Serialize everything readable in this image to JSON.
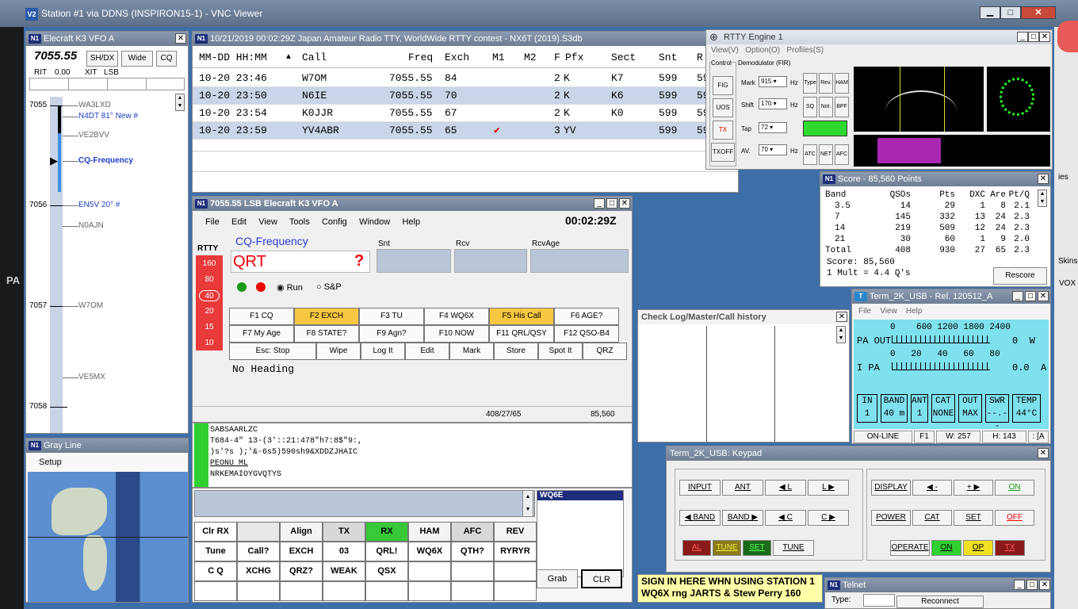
{
  "vnc": {
    "title": "Station #1 via DDNS (INSPIRON15-1) - VNC Viewer",
    "logo": "V2"
  },
  "bandmap": {
    "title": "Elecraft K3 VFO A",
    "freq": "7055.55",
    "btn_shdx": "SH/DX",
    "btn_wide": "Wide",
    "btn_cq": "CQ",
    "rit": "RIT",
    "rit_val": "0.00",
    "xit": "XIT",
    "mode": "LSB",
    "ticks": [
      {
        "label": "7055"
      },
      {
        "label": "7056"
      },
      {
        "label": "7057"
      },
      {
        "label": "7058"
      }
    ],
    "spots": [
      {
        "call": "WA3LXD",
        "color": "gray"
      },
      {
        "call": "N4DT 81° New #",
        "color": "blue"
      },
      {
        "call": "VE2BVV",
        "color": "gray"
      },
      {
        "call": "CQ-Frequency",
        "color": "blue"
      },
      {
        "call": "EN5V 20° #",
        "color": "blue"
      },
      {
        "call": "N0AJN",
        "color": "gray"
      },
      {
        "call": "W7OM",
        "color": "gray"
      },
      {
        "call": "VE5MX",
        "color": "gray"
      }
    ]
  },
  "grayline": {
    "title": "Gray Line",
    "setup": "Setup"
  },
  "log": {
    "title": "10/21/2019 00:02:29Z  Japan Amateur Radio TTY, WorldWide RTTY contest - NX6T (2019).S3db",
    "headers": [
      "MM-DD HH:MM",
      "Call",
      "Freq",
      "Exch",
      "M1",
      "M2",
      "F",
      "Pfx",
      "Sect",
      "Snt",
      "R"
    ],
    "rows": [
      {
        "dt": "10-20 23:46",
        "call": "W7OM",
        "freq": "7055.55",
        "exch": "84",
        "m1": "",
        "f": "2",
        "pfx": "K",
        "sect": "K7",
        "snt": "599",
        "r": "59"
      },
      {
        "dt": "10-20 23:50",
        "call": "N6IE",
        "freq": "7055.55",
        "exch": "70",
        "m1": "",
        "f": "2",
        "pfx": "K",
        "sect": "K6",
        "snt": "599",
        "r": "59"
      },
      {
        "dt": "10-20 23:54",
        "call": "K0JJR",
        "freq": "7055.55",
        "exch": "67",
        "m1": "",
        "f": "2",
        "pfx": "K",
        "sect": "K0",
        "snt": "599",
        "r": "59"
      },
      {
        "dt": "10-20 23:59",
        "call": "YV4ABR",
        "freq": "7055.55",
        "exch": "65",
        "m1": "✔",
        "f": "3",
        "pfx": "YV",
        "sect": "",
        "snt": "599",
        "r": "59"
      }
    ]
  },
  "entry": {
    "title": "7055.55 LSB Elecraft K3 VFO A",
    "menu": [
      "File",
      "Edit",
      "View",
      "Tools",
      "Config",
      "Window",
      "Help"
    ],
    "clock": "00:02:29Z",
    "mode": "RTTY",
    "freq_label": "CQ-Frequency",
    "call": "QRT",
    "q": "?",
    "snt": "Snt",
    "rcv": "Rcv",
    "rcvage": "RcvAge",
    "run": "Run",
    "sp": "S&P",
    "levels": [
      "160",
      "80",
      "40",
      "20",
      "15",
      "10"
    ],
    "fkeys": [
      "F1 CQ",
      "F2 EXCH",
      "F3 TU",
      "F4 WQ6X",
      "F5 His Call",
      "F6 AGE?",
      "F7 My Age",
      "F8 STATE?",
      "F9 Agn?",
      "F10 NOW",
      "F11 QRL/QSY",
      "F12 QSO-B4"
    ],
    "actions": [
      "Esc: Stop",
      "Wipe",
      "Log It",
      "Edit",
      "Mark",
      "Store",
      "Spot It",
      "QRZ"
    ],
    "heading": "No Heading",
    "status_count": "408/27/65",
    "status_score": "85,560"
  },
  "rtty": {
    "title": "RTTY Engine 1",
    "menu": [
      "View(V)",
      "Option(O)",
      "Profiles(S)"
    ],
    "control": "Control",
    "demod": "Demodulator (FIR)",
    "left_btns": [
      "FIG",
      "UOS",
      "TX",
      "TXOFF"
    ],
    "mark_lbl": "Mark",
    "mark_val": "915",
    "shift_lbl": "Shift",
    "shift_val": "170",
    "tap_lbl": "Tap",
    "tap_val": "72",
    "av_lbl": "AV.",
    "av_val": "70",
    "hz": "Hz",
    "r_btns": [
      "Type",
      "Rev.",
      "HAM",
      "SQ",
      "Not.",
      "BPF",
      "ATC",
      "NET",
      "AFC"
    ]
  },
  "rxtext": {
    "lines": [
      "SABSAARLZC",
      "T684-4\" 13-(3'::21:478\"h7:8$\"9:,",
      ")s'?s );'&-6s5)590sh9&XDDZJHAIC",
      "PEONU ML",
      "NRKEMAIOYGVQTYS"
    ]
  },
  "macros": {
    "rows": [
      [
        "Clr RX",
        "",
        "Align",
        "TX",
        "RX",
        "HAM",
        "AFC",
        "REV"
      ],
      [
        "Tune",
        "Call?",
        "EXCH",
        "03",
        "QRL!",
        "WQ6X",
        "QTH?",
        "RYRYR"
      ],
      [
        "C Q",
        "XCHG",
        "QRZ?",
        "WEAK",
        "QSX",
        "",
        "",
        ""
      ]
    ],
    "call_box": "WQ6E",
    "grab": "Grab",
    "clr": "CLR"
  },
  "score": {
    "title": "Score - 85,560 Points",
    "headers": [
      "Band",
      "QSOs",
      "Pts",
      "DXC",
      "Are",
      "Pt/Q"
    ],
    "rows": [
      [
        "3.5",
        "14",
        "29",
        "1",
        "8",
        "2.1"
      ],
      [
        "7",
        "145",
        "332",
        "13",
        "24",
        "2.3"
      ],
      [
        "14",
        "219",
        "509",
        "12",
        "24",
        "2.3"
      ],
      [
        "21",
        "30",
        "60",
        "1",
        "9",
        "2.0"
      ],
      [
        "Total",
        "408",
        "930",
        "27",
        "65",
        "2.3"
      ]
    ],
    "score_line": "Score: 85,560",
    "mult_line": "1 Mult = 4.4 Q's",
    "rescore": "Rescore"
  },
  "checklog": {
    "title": "Check Log/Master/Call history"
  },
  "term": {
    "title": "Term_2K_USB - Rel. 120512_A",
    "menu": [
      "File",
      "View",
      "Help"
    ],
    "pa_out": "PA OUT",
    "pa_scale": "0    600 1200 1800 2400",
    "pa_unit": "0  W",
    "ipa": "I PA",
    "ipa_scale": "0   20   40   60   80",
    "ipa_unit": "0.0  A",
    "cells": [
      [
        "IN",
        "1"
      ],
      [
        "BAND",
        "40 m"
      ],
      [
        "ANT",
        "1"
      ],
      [
        "CAT",
        "NONE"
      ],
      [
        "OUT",
        "MAX"
      ],
      [
        "SWR",
        "--.--"
      ],
      [
        "TEMP",
        "44°C"
      ]
    ],
    "status": [
      "ON-LINE",
      "F1",
      "W:  257",
      "H:  143",
      ": [A"
    ]
  },
  "keypad": {
    "title": "Term_2K_USB: Keypad",
    "r1": [
      "INPUT",
      "ANT",
      "◀ L",
      "L ▶"
    ],
    "r2": [
      "◀ BAND",
      "BAND ▶",
      "◀ C",
      "C ▶"
    ],
    "r3": [
      "AL",
      "TUNE",
      "SET",
      "TUNE"
    ],
    "rr1": [
      "DISPLAY",
      "◀ -",
      "+ ▶",
      "ON"
    ],
    "rr2": [
      "POWER",
      "CAT",
      "SET",
      "OFF"
    ],
    "rr3": [
      "OPERATE",
      "ON",
      "OP",
      "TX"
    ]
  },
  "notice": {
    "line1": "SIGN IN HERE WHN USING STATION 1",
    "line2": "WQ6X rng JARTS & Stew Perry 160"
  },
  "telnet": {
    "title": "Telnet",
    "type": "Type:",
    "reconnect": "Reconnect"
  },
  "desktop": {
    "pa": "PA",
    "skins": "Skins",
    "vox": "VOX",
    "ies": "ies"
  }
}
